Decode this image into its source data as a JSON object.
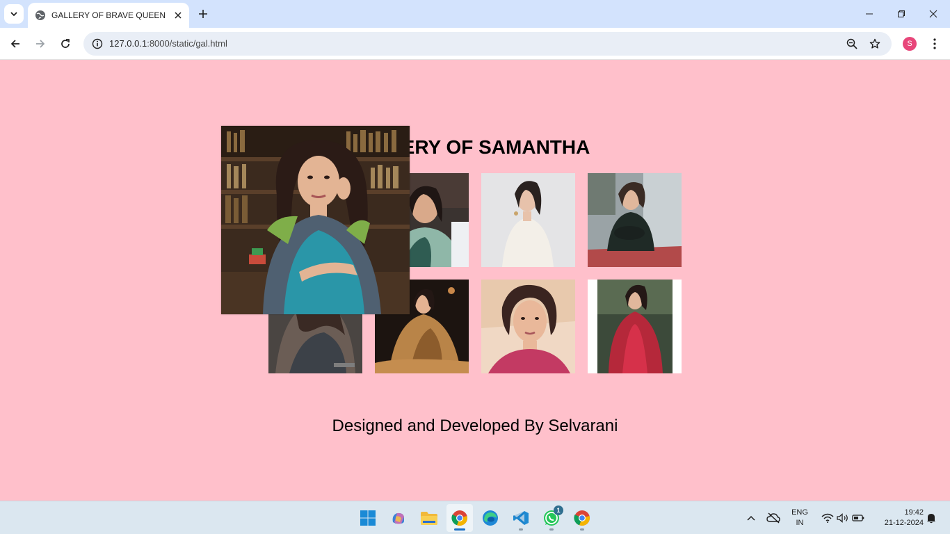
{
  "browser": {
    "tab_title": "GALLERY OF BRAVE QUEEN",
    "url_host": "127.0.0.1",
    "url_rest": ":8000/static/gal.html",
    "profile_initial": "S",
    "accent": "#d3e3fd"
  },
  "page": {
    "background": "#ffc0cb",
    "heading": "ERY OF SAMANTHA",
    "footer": "Designed and Developed By Selvarani",
    "photos": [
      {
        "id": "photo-1",
        "desc": "portrait in reading room, hovered enlarged"
      },
      {
        "id": "photo-2",
        "desc": "smiling in green saree"
      },
      {
        "id": "photo-3",
        "desc": "white outfit portrait"
      },
      {
        "id": "photo-4",
        "desc": "seated in black outfit"
      },
      {
        "id": "photo-5",
        "desc": "partially hidden portrait"
      },
      {
        "id": "photo-6",
        "desc": "golden saree on stage"
      },
      {
        "id": "photo-7",
        "desc": "close-up in pink saree"
      },
      {
        "id": "photo-8",
        "desc": "red jacket outfit"
      }
    ]
  },
  "taskbar": {
    "apps": [
      "start-icon",
      "copilot-icon",
      "file-explorer-icon",
      "chrome-icon",
      "edge-icon",
      "vscode-icon",
      "whatsapp-icon",
      "chrome-profile-icon"
    ],
    "whatsapp_badge": "1",
    "lang_line1": "ENG",
    "lang_line2": "IN",
    "time": "19:42",
    "date": "21-12-2024"
  }
}
